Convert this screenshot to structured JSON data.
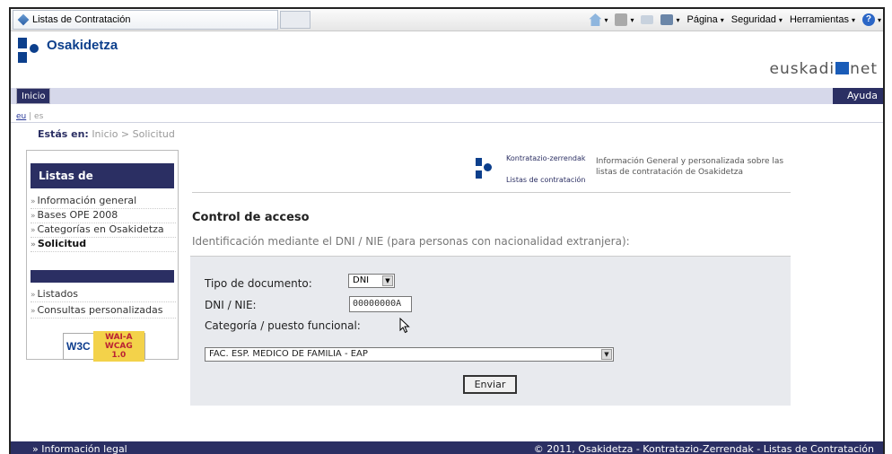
{
  "browser": {
    "tab_title": "Listas de Contratación",
    "commands": [
      "Página",
      "Seguridad",
      "Herramientas"
    ]
  },
  "header": {
    "brand": "Osakidetza",
    "euskadi": "euskadi",
    "euskadi_suffix": "net",
    "nav_home": "Inicio",
    "nav_help": "Ayuda"
  },
  "lang": {
    "active": "eu",
    "separator": "|",
    "other": "es"
  },
  "breadcrumb": {
    "prefix": "Estás en:",
    "home": "Inicio",
    "sep": ">",
    "current": "Solicitud"
  },
  "sidebar": {
    "title": "Listas de Contratación",
    "items": [
      {
        "label": "Información general"
      },
      {
        "label": "Bases OPE 2008"
      },
      {
        "label": "Categorías en Osakidetza"
      },
      {
        "label": "Solicitud"
      },
      {
        "label": "Listados"
      },
      {
        "label": "Consultas personalizadas"
      }
    ],
    "wai_w3c": "W3C",
    "wai_level": "WAI-A",
    "wai_wcag": "WCAG 1.0"
  },
  "promo": {
    "line1": "Kontratazio-zerrendak",
    "line2": "Listas de contratación",
    "desc": "Información General y personalizada sobre las listas de contratación de Osakidetza"
  },
  "main": {
    "title": "Control de acceso",
    "subtitle": "Identificación mediante el DNI / NIE (para personas con nacionalidad extranjera):",
    "doc_type_label": "Tipo de documento:",
    "doc_type_value": "DNI",
    "dni_label": "DNI / NIE:",
    "dni_value": "00000000A",
    "category_label": "Categoría / puesto funcional:",
    "category_value": "FAC. ESP. MEDICO DE FAMILIA - EAP",
    "submit": "Enviar"
  },
  "footer": {
    "legal": "» Información legal",
    "copyright": "© 2011, Osakidetza - Kontratazio-Zerrendak - Listas de Contratación"
  },
  "colors": {
    "navy": "#2b2f63",
    "brand_blue": "#0c3f8c"
  }
}
